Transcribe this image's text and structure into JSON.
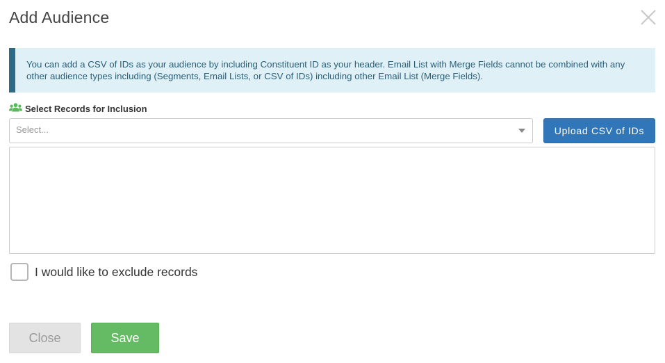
{
  "modal": {
    "title": "Add Audience",
    "close_icon": "close-x-icon"
  },
  "info": {
    "text": "You can add a CSV of IDs as your audience by including Constituent ID as your header. Email List with Merge Fields cannot be combined with any other audience types including (Segments, Email Lists, or CSV of IDs) including other Email List (Merge Fields)."
  },
  "inclusion": {
    "label": "Select Records for Inclusion",
    "icon": "users-icon",
    "icon_color": "#5cb85c",
    "select_placeholder": "Select...",
    "upload_label": "Upload CSV of IDs"
  },
  "exclude": {
    "label": "I would like to exclude records",
    "checked": false
  },
  "footer": {
    "close_label": "Close",
    "save_label": "Save"
  },
  "colors": {
    "primary": "#3176b8",
    "success": "#5cb85c",
    "info_bg": "#dff0f7",
    "info_border": "#2d6a85"
  }
}
